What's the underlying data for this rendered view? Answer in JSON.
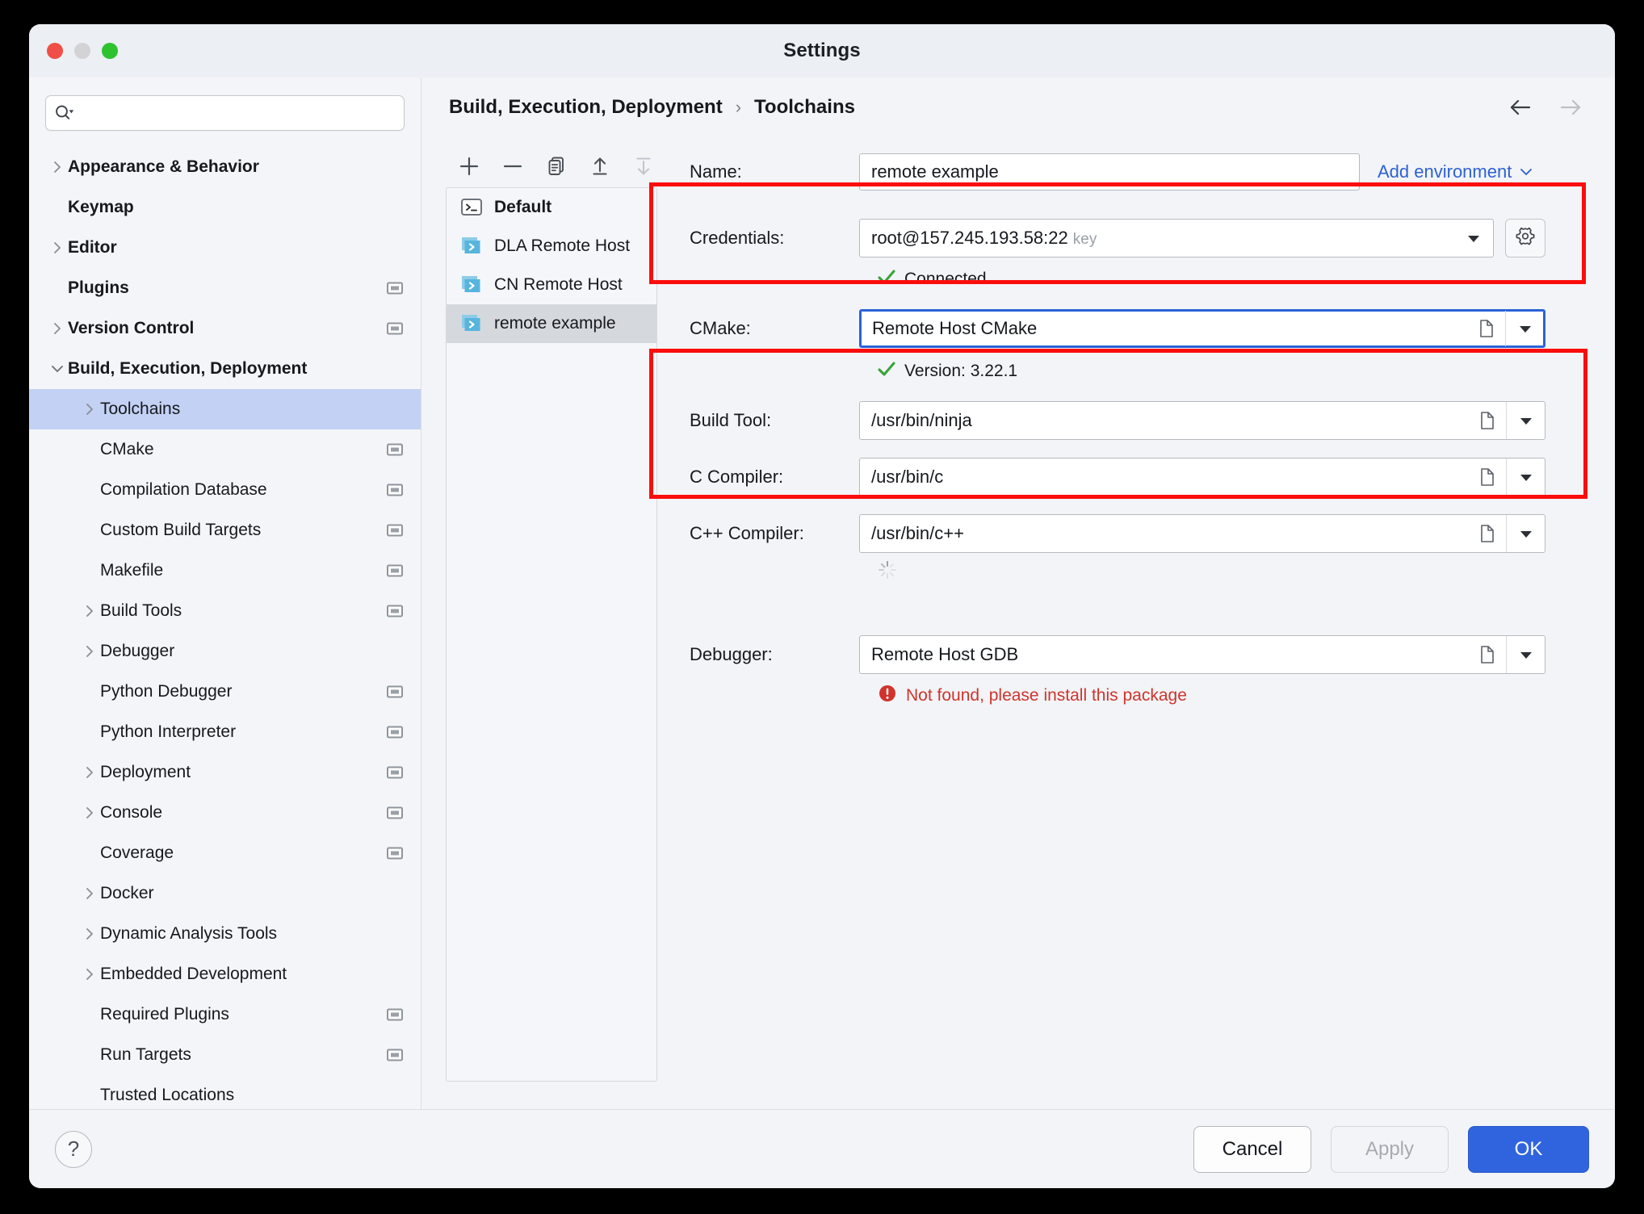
{
  "window": {
    "title": "Settings",
    "traffic_lights": [
      "close-button",
      "minimize-button",
      "zoom-button"
    ]
  },
  "search": {
    "value": "",
    "placeholder": ""
  },
  "sidebar": {
    "items": [
      {
        "label": "Appearance & Behavior",
        "indent": 0,
        "chevron": "right",
        "bold": true,
        "selected": false,
        "indicator": false
      },
      {
        "label": "Keymap",
        "indent": 0,
        "chevron": "none",
        "bold": true,
        "selected": false,
        "indicator": false
      },
      {
        "label": "Editor",
        "indent": 0,
        "chevron": "right",
        "bold": true,
        "selected": false,
        "indicator": false
      },
      {
        "label": "Plugins",
        "indent": 0,
        "chevron": "none",
        "bold": true,
        "selected": false,
        "indicator": true
      },
      {
        "label": "Version Control",
        "indent": 0,
        "chevron": "right",
        "bold": true,
        "selected": false,
        "indicator": true
      },
      {
        "label": "Build, Execution, Deployment",
        "indent": 0,
        "chevron": "down",
        "bold": true,
        "selected": false,
        "indicator": false
      },
      {
        "label": "Toolchains",
        "indent": 1,
        "chevron": "right",
        "bold": false,
        "selected": true,
        "indicator": false
      },
      {
        "label": "CMake",
        "indent": 1,
        "chevron": "none",
        "bold": false,
        "selected": false,
        "indicator": true
      },
      {
        "label": "Compilation Database",
        "indent": 1,
        "chevron": "none",
        "bold": false,
        "selected": false,
        "indicator": true
      },
      {
        "label": "Custom Build Targets",
        "indent": 1,
        "chevron": "none",
        "bold": false,
        "selected": false,
        "indicator": true
      },
      {
        "label": "Makefile",
        "indent": 1,
        "chevron": "none",
        "bold": false,
        "selected": false,
        "indicator": true
      },
      {
        "label": "Build Tools",
        "indent": 1,
        "chevron": "right",
        "bold": false,
        "selected": false,
        "indicator": true
      },
      {
        "label": "Debugger",
        "indent": 1,
        "chevron": "right",
        "bold": false,
        "selected": false,
        "indicator": false
      },
      {
        "label": "Python Debugger",
        "indent": 1,
        "chevron": "none",
        "bold": false,
        "selected": false,
        "indicator": true
      },
      {
        "label": "Python Interpreter",
        "indent": 1,
        "chevron": "none",
        "bold": false,
        "selected": false,
        "indicator": true
      },
      {
        "label": "Deployment",
        "indent": 1,
        "chevron": "right",
        "bold": false,
        "selected": false,
        "indicator": true
      },
      {
        "label": "Console",
        "indent": 1,
        "chevron": "right",
        "bold": false,
        "selected": false,
        "indicator": true
      },
      {
        "label": "Coverage",
        "indent": 1,
        "chevron": "none",
        "bold": false,
        "selected": false,
        "indicator": true
      },
      {
        "label": "Docker",
        "indent": 1,
        "chevron": "right",
        "bold": false,
        "selected": false,
        "indicator": false
      },
      {
        "label": "Dynamic Analysis Tools",
        "indent": 1,
        "chevron": "right",
        "bold": false,
        "selected": false,
        "indicator": false
      },
      {
        "label": "Embedded Development",
        "indent": 1,
        "chevron": "right",
        "bold": false,
        "selected": false,
        "indicator": false
      },
      {
        "label": "Required Plugins",
        "indent": 1,
        "chevron": "none",
        "bold": false,
        "selected": false,
        "indicator": true
      },
      {
        "label": "Run Targets",
        "indent": 1,
        "chevron": "none",
        "bold": false,
        "selected": false,
        "indicator": true
      },
      {
        "label": "Trusted Locations",
        "indent": 1,
        "chevron": "none",
        "bold": false,
        "selected": false,
        "indicator": false
      }
    ]
  },
  "breadcrumb": {
    "parent": "Build, Execution, Deployment",
    "separator": "›",
    "current": "Toolchains",
    "back_enabled": true,
    "forward_enabled": false
  },
  "toolchain_toolbar": [
    {
      "name": "add-toolchain-button",
      "glyph": "plus",
      "enabled": true
    },
    {
      "name": "remove-toolchain-button",
      "glyph": "minus",
      "enabled": true
    },
    {
      "name": "copy-toolchain-button",
      "glyph": "copy",
      "enabled": true
    },
    {
      "name": "move-up-button",
      "glyph": "arrow-up",
      "enabled": true
    },
    {
      "name": "move-down-button",
      "glyph": "arrow-down",
      "enabled": false
    }
  ],
  "toolchain_list": [
    {
      "label": "Default",
      "icon": "terminal-icon",
      "bold": true,
      "selected": false
    },
    {
      "label": "DLA Remote Host",
      "icon": "remote-host-icon",
      "bold": false,
      "selected": false
    },
    {
      "label": "CN Remote Host",
      "icon": "remote-host-icon",
      "bold": false,
      "selected": false
    },
    {
      "label": "remote example",
      "icon": "remote-host-icon",
      "bold": false,
      "selected": true
    }
  ],
  "form": {
    "name": {
      "label": "Name:",
      "value": "remote example",
      "placeholder": ""
    },
    "add_environment": {
      "label": "Add environment",
      "chevron": "chevron-down-icon"
    },
    "credentials": {
      "label": "Credentials:",
      "value": "root@157.245.193.58:22",
      "suffix": "key",
      "status_text": "Connected",
      "status_type": "ok",
      "gear": "gear-icon"
    },
    "cmake": {
      "label": "CMake:",
      "value": "Remote Host CMake",
      "status_text": "Version: 3.22.1",
      "status_type": "ok",
      "focused": true
    },
    "build_tool": {
      "label": "Build Tool:",
      "value": "/usr/bin/ninja"
    },
    "c_compiler": {
      "label": "C Compiler:",
      "value": "/usr/bin/c"
    },
    "cxx_compiler": {
      "label": "C++ Compiler:",
      "value": "/usr/bin/c++"
    },
    "loading_indicator": "spinner-icon",
    "debugger": {
      "label": "Debugger:",
      "value": "Remote Host GDB",
      "status_text": "Not found, please install this package",
      "status_type": "error"
    }
  },
  "footer": {
    "help_label": "?",
    "cancel_label": "Cancel",
    "apply_label": "Apply",
    "apply_enabled": false,
    "ok_label": "OK"
  },
  "colors": {
    "accent_blue": "#3064df",
    "link_blue": "#2d62d4",
    "highlight_red": "#fb0d0d",
    "success_green": "#3aa33a",
    "error_red": "#d0342c",
    "selection_blue": "#c3d1f4"
  }
}
